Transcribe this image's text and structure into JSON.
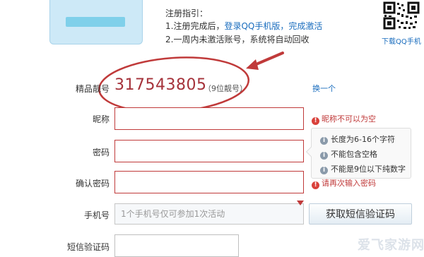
{
  "guide": {
    "title": "注册指引：",
    "step1_prefix": "1.注册完成后，",
    "step1_link1": "登录QQ手机版",
    "step1_sep": "，",
    "step1_link2": "完成激活",
    "step2": "2.一周内未激活账号，系统将自动回收"
  },
  "qr": {
    "caption": "下载QQ手机"
  },
  "premium": {
    "label": "精品靓号",
    "number": "317543805",
    "hint": "（9位靓号）",
    "refresh": "换一个"
  },
  "nickname": {
    "label": "昵称",
    "error": "昵称不可以为空"
  },
  "password": {
    "label": "密码",
    "rules": [
      "长度为6-16个字符",
      "不能包含空格",
      "不能是9位以下纯数字"
    ]
  },
  "confirm": {
    "label": "确认密码",
    "error": "请再次输入密码"
  },
  "phone": {
    "label": "手机号",
    "placeholder": "1个手机号仅可参加1次活动",
    "sms_button": "获取短信验证码"
  },
  "sms_code": {
    "label": "短信验证码"
  },
  "icons": {
    "error": "exclamation-icon",
    "info": "info-icon",
    "arrow": "red-arrow-icon",
    "highlight": "red-ellipse"
  },
  "colors": {
    "accent_red": "#c03a3a",
    "number_red": "#a5323a",
    "link_blue": "#1a6dbe"
  },
  "watermark": "爱飞家游网"
}
